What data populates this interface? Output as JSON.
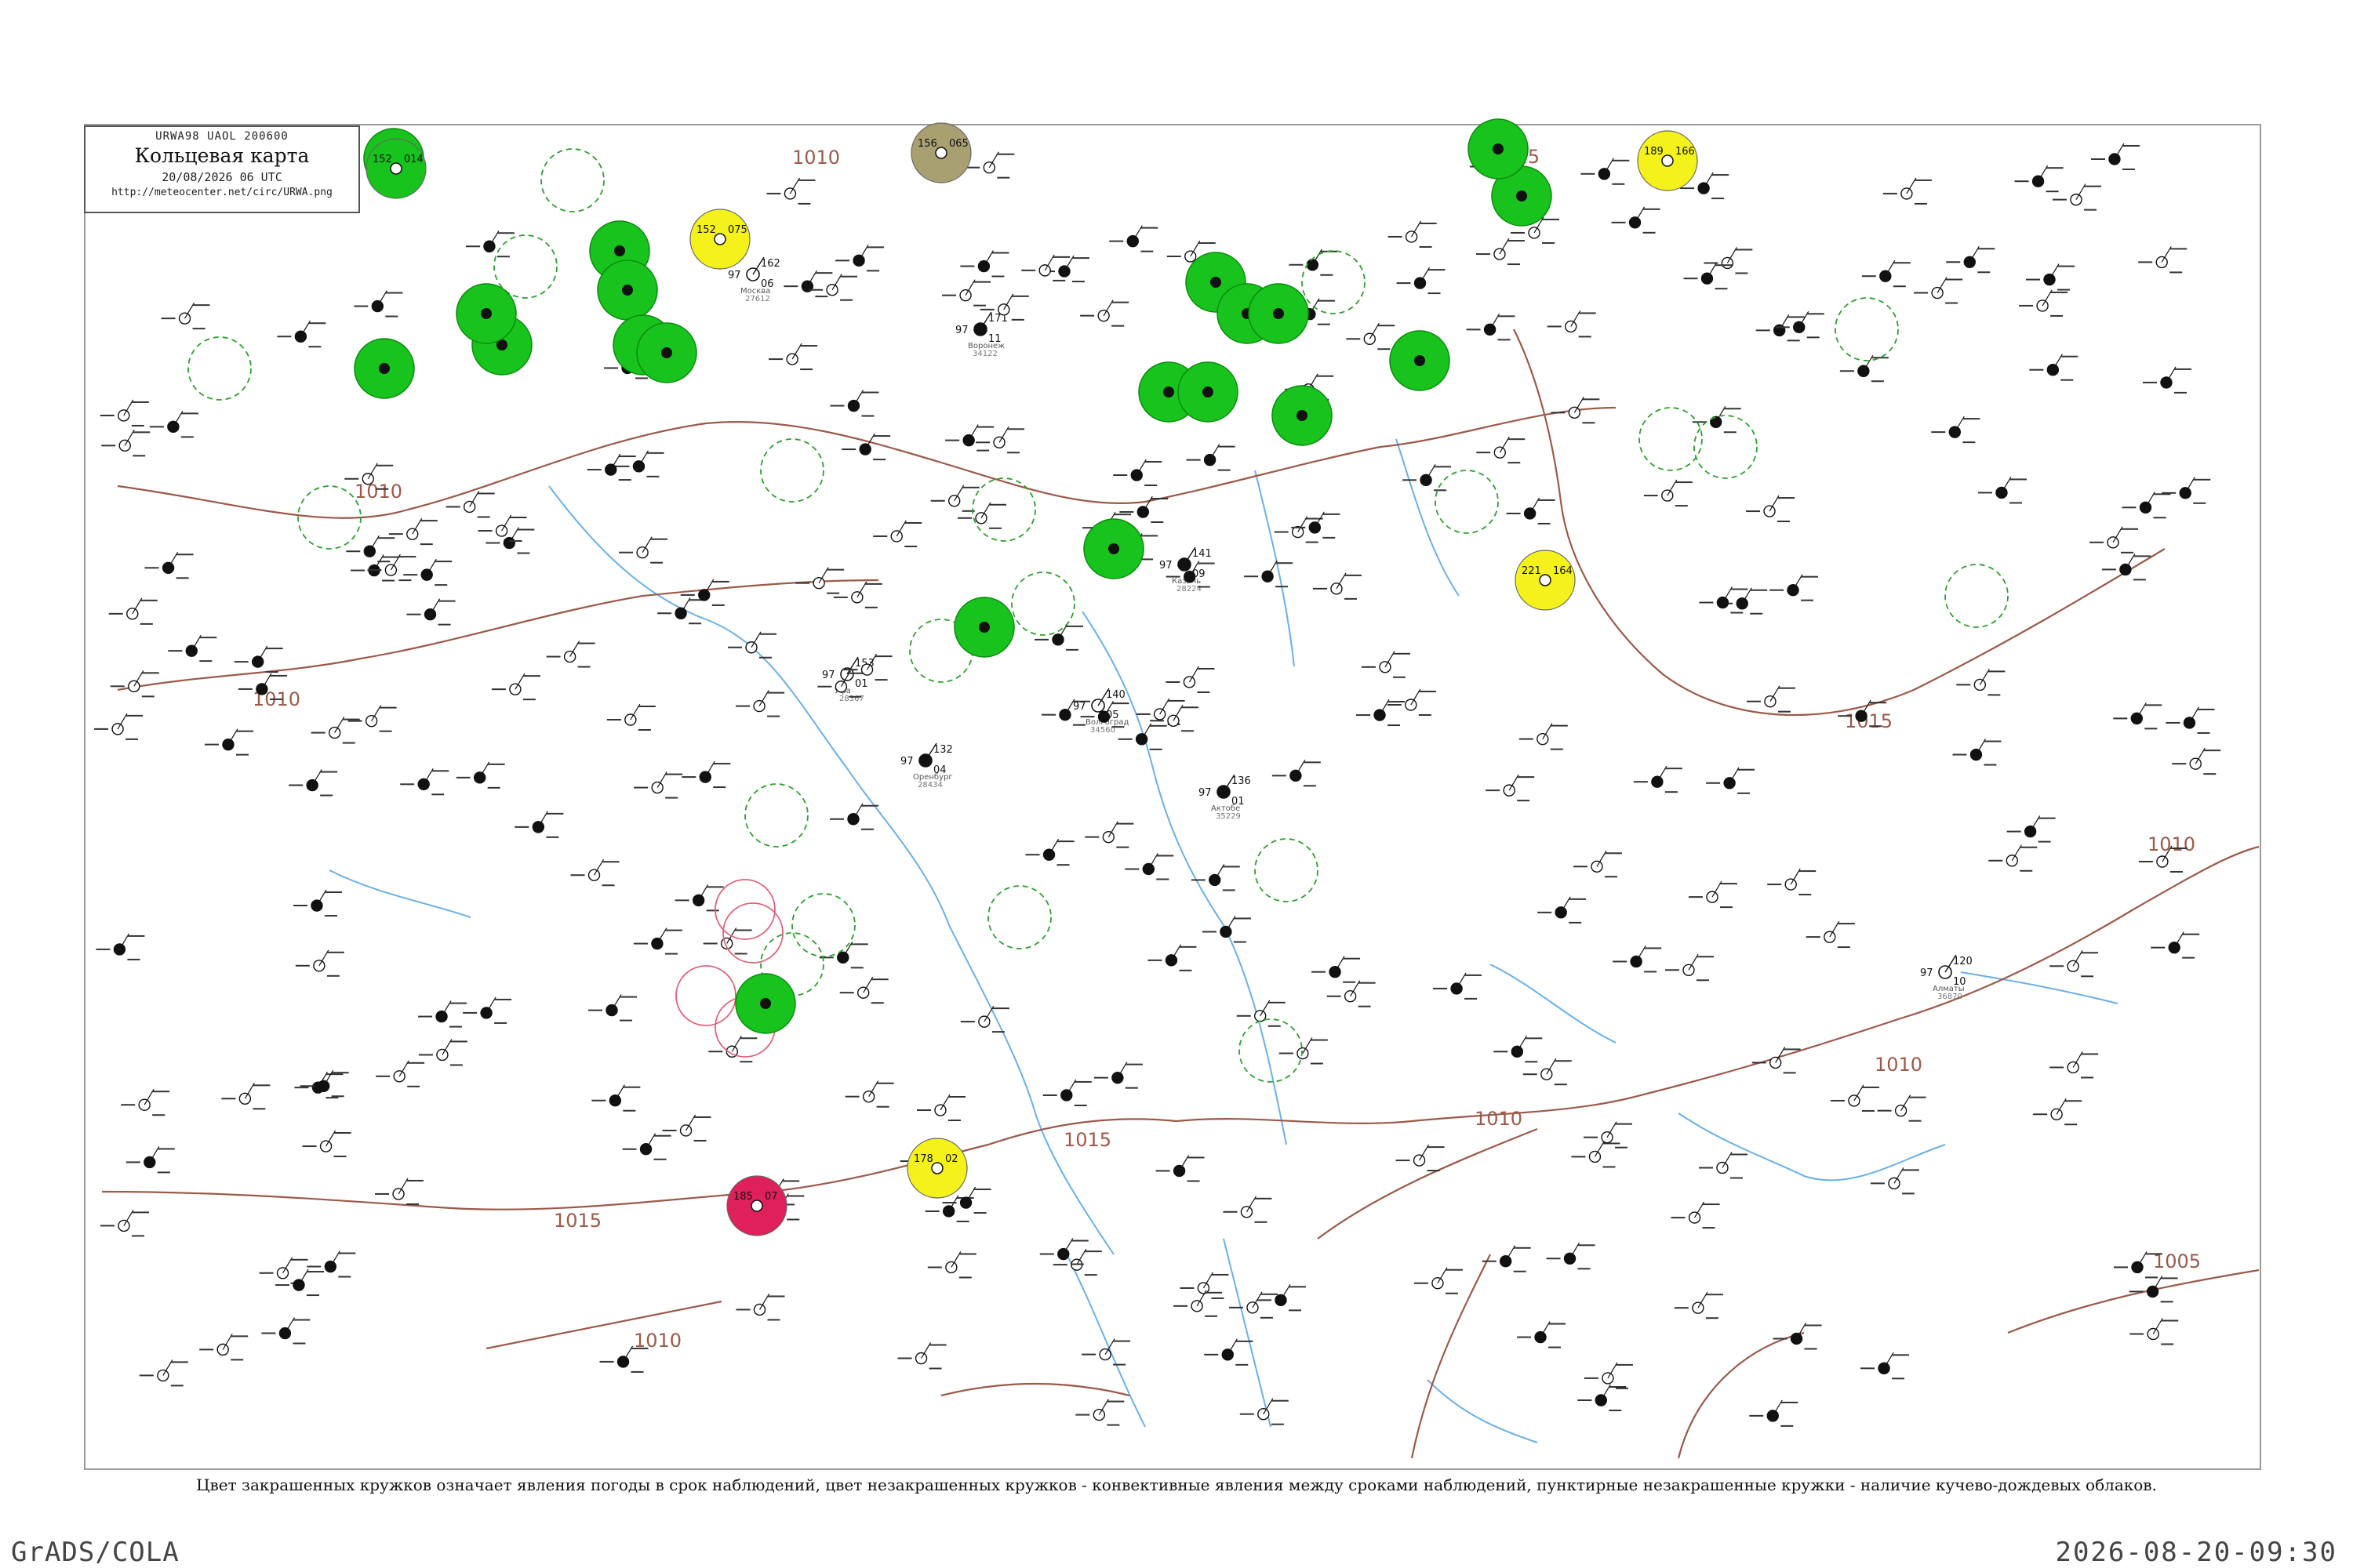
{
  "header": {
    "product_code": "URWA98  UAOL  200600",
    "title": "Кольцевая карта",
    "datetime": "20/08/2026 06 UTC",
    "url": "http://meteocenter.net/circ/URWA.png"
  },
  "caption": "Цвет закрашенных кружков означает явления погоды в срок наблюдений, цвет незакрашенных кружков - конвективные явления между сроками наблюдений, пунктирные незакрашенные кружки - наличие кучево-дождевых облаков.",
  "footer": {
    "left": "GrADS/COLA",
    "right": "2026-08-20-09:30"
  },
  "colors": {
    "frame": "#9a9a9a",
    "isobar": "#9b5a4a",
    "river": "#6ab0e8",
    "rain_fill": "#17c31c",
    "shower_fill": "#f4f21a",
    "haze_fill": "#a8a070",
    "thunder_fill": "#e0205a",
    "cb_circle": "#2ca02c",
    "thunder_circle": "#e0607a"
  },
  "isobar_labels": [
    "1010",
    "1010",
    "1010",
    "1015",
    "1015",
    "1015",
    "1010",
    "1010",
    "1010",
    "1010",
    "1005",
    "1015"
  ],
  "stations": [
    {
      "code": "28224",
      "name": "Казань",
      "p": "141",
      "t": "97",
      "w": "09"
    },
    {
      "code": "28367",
      "name": "Уфа",
      "p": "153",
      "t": "97",
      "w": "01"
    },
    {
      "code": "28434",
      "name": "Оренбург",
      "p": "132",
      "t": "97",
      "w": "04"
    },
    {
      "code": "27612",
      "name": "Москва",
      "p": "162",
      "t": "97",
      "w": "06"
    },
    {
      "code": "34122",
      "name": "Воронеж",
      "p": "171",
      "t": "97",
      "w": "11"
    },
    {
      "code": "34560",
      "name": "Волгоград",
      "p": "140",
      "t": "97",
      "w": "05"
    },
    {
      "code": "35229",
      "name": "Актобе",
      "p": "136",
      "t": "97",
      "w": "01"
    },
    {
      "code": "36870",
      "name": "Алматы",
      "p": "120",
      "t": "97",
      "w": "10"
    }
  ],
  "marked_stations": [
    {
      "kind": "rain",
      "p": "152",
      "w": "014"
    },
    {
      "kind": "shower",
      "p": "152",
      "w": "075"
    },
    {
      "kind": "haze",
      "p": "156",
      "w": "065"
    },
    {
      "kind": "shower",
      "p": "189",
      "w": "166"
    },
    {
      "kind": "shower",
      "p": "221",
      "w": "164"
    },
    {
      "kind": "shower",
      "p": "178",
      "w": "02"
    },
    {
      "kind": "thunder",
      "p": "185",
      "w": "07"
    }
  ]
}
